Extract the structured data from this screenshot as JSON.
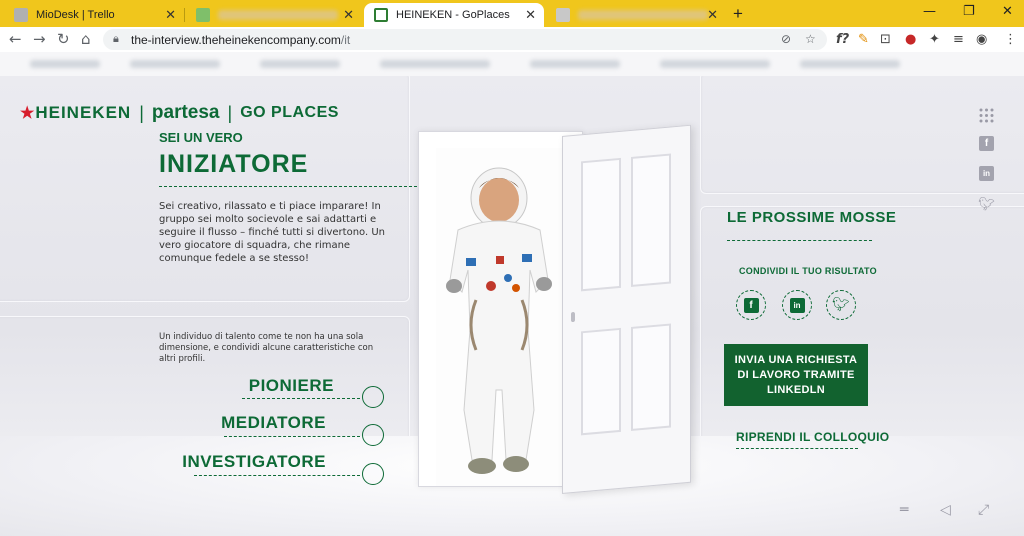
{
  "browser": {
    "tabs": [
      {
        "title": "MioDesk | Trello",
        "favicon_color": "#b0b0b0",
        "active": false
      },
      {
        "title": "",
        "favicon_color": "#7fbf6a",
        "active": false
      },
      {
        "title": "HEINEKEN - GoPlaces",
        "favicon_color": "#2e7d32",
        "active": true
      },
      {
        "title": "",
        "favicon_color": "#c8c8c8",
        "active": false
      }
    ],
    "new_tab": "+",
    "window_controls": {
      "minimize": "—",
      "restore": "❐",
      "close": "✕"
    },
    "url_host": "the-interview.theheinekencompany.com",
    "url_path": "/it",
    "icons": {
      "back": "←",
      "forward": "→",
      "reload": "↻",
      "home": "⌂",
      "lock": "🔒",
      "hide": "⊘",
      "star": "☆",
      "ext1": "f?",
      "ext2": "✎",
      "ext3": "⊡",
      "ext4": "●",
      "ext5": "✦",
      "ext6": "≡",
      "profile": "◉",
      "menu": "⋮"
    }
  },
  "page": {
    "logo": {
      "brand1": "HEINEKEN",
      "separator": "|",
      "brand2": "partesa",
      "brand3": "GO PLACES"
    },
    "subtitle": "SEI UN VERO",
    "title": "INIZIATORE",
    "description": "Sei creativo, rilassato e ti piace imparare! In gruppo sei molto socievole e sai adattarti e seguire il flusso – finché tutti si divertono. Un vero giocatore di squadra, che rimane comunque fedele a se stesso!",
    "description2": "Un individuo di talento come te non ha una sola dimensione, e condividi alcune caratteristiche con altri profili.",
    "profiles": [
      "PIONIERE",
      "MEDIATORE",
      "INVESTIGATORE"
    ],
    "next_steps": "LE PROSSIME MOSSE",
    "share_label": "CONDIVIDI IL TUO RISULTATO",
    "social": [
      "f",
      "in",
      "t"
    ],
    "cta": "INVIA UNA RICHIESTA DI LAVORO TRAMITE LINKEDLN",
    "resume": "RIPRENDI IL COLLOQUIO",
    "side_icons": {
      "grid": "⋮⋮",
      "facebook": "f",
      "linkedin": "in",
      "twitter": "t"
    },
    "bottom_icons": {
      "menu": "═",
      "sound": "◁",
      "fullscreen": "⤢"
    },
    "accent_color": "#0d6a36",
    "brand_red": "#d71d2c"
  }
}
